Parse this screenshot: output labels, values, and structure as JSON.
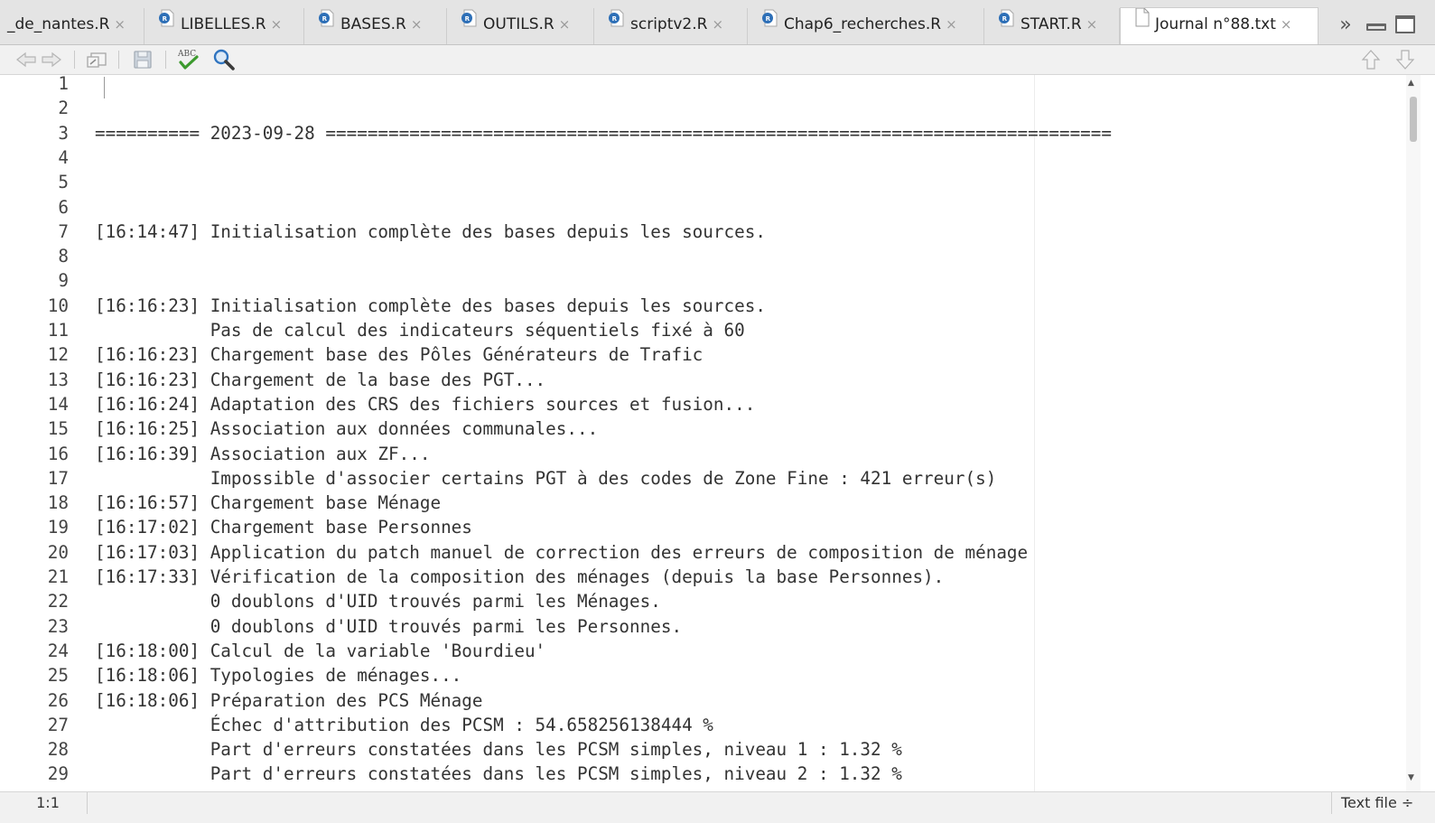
{
  "tabs": [
    {
      "label": "_de_nantes.R",
      "type": "r"
    },
    {
      "label": "LIBELLES.R",
      "type": "r"
    },
    {
      "label": "BASES.R",
      "type": "r"
    },
    {
      "label": "OUTILS.R",
      "type": "r"
    },
    {
      "label": "scriptv2.R",
      "type": "r"
    },
    {
      "label": "Chap6_recherches.R",
      "type": "r"
    },
    {
      "label": "START.R",
      "type": "r"
    },
    {
      "label": "Journal n°88.txt",
      "type": "text",
      "active": true
    }
  ],
  "tab_close_glyph": "×",
  "tab_overflow_glyph": "»",
  "toolbar": {
    "icons": [
      "back-arrow-icon",
      "forward-arrow-icon",
      "show-in-window-icon",
      "save-icon",
      "spellcheck-icon",
      "search-icon",
      "go-up-icon",
      "go-down-icon"
    ],
    "spellcheck_text": "ABC"
  },
  "editor": {
    "lines": [
      {
        "n": "1",
        "text": ""
      },
      {
        "n": "2",
        "text": ""
      },
      {
        "n": "3",
        "text": "========== 2023-09-28 ==========================================================================="
      },
      {
        "n": "4",
        "text": ""
      },
      {
        "n": "5",
        "text": ""
      },
      {
        "n": "6",
        "text": ""
      },
      {
        "n": "7",
        "text": "[16:14:47] Initialisation complète des bases depuis les sources."
      },
      {
        "n": "8",
        "text": ""
      },
      {
        "n": "9",
        "text": ""
      },
      {
        "n": "10",
        "text": "[16:16:23] Initialisation complète des bases depuis les sources."
      },
      {
        "n": "11",
        "text": "           Pas de calcul des indicateurs séquentiels fixé à 60"
      },
      {
        "n": "12",
        "text": "[16:16:23] Chargement base des Pôles Générateurs de Trafic"
      },
      {
        "n": "13",
        "text": "[16:16:23] Chargement de la base des PGT..."
      },
      {
        "n": "14",
        "text": "[16:16:24] Adaptation des CRS des fichiers sources et fusion..."
      },
      {
        "n": "15",
        "text": "[16:16:25] Association aux données communales..."
      },
      {
        "n": "16",
        "text": "[16:16:39] Association aux ZF..."
      },
      {
        "n": "17",
        "text": "           Impossible d'associer certains PGT à des codes de Zone Fine : 421 erreur(s)"
      },
      {
        "n": "18",
        "text": "[16:16:57] Chargement base Ménage"
      },
      {
        "n": "19",
        "text": "[16:17:02] Chargement base Personnes"
      },
      {
        "n": "20",
        "text": "[16:17:03] Application du patch manuel de correction des erreurs de composition de ménage"
      },
      {
        "n": "21",
        "text": "[16:17:33] Vérification de la composition des ménages (depuis la base Personnes)."
      },
      {
        "n": "22",
        "text": "           0 doublons d'UID trouvés parmi les Ménages."
      },
      {
        "n": "23",
        "text": "           0 doublons d'UID trouvés parmi les Personnes."
      },
      {
        "n": "24",
        "text": "[16:18:00] Calcul de la variable 'Bourdieu'"
      },
      {
        "n": "25",
        "text": "[16:18:06] Typologies de ménages..."
      },
      {
        "n": "26",
        "text": "[16:18:06] Préparation des PCS Ménage"
      },
      {
        "n": "27",
        "text": "           Échec d'attribution des PCSM : 54.658256138444 %"
      },
      {
        "n": "28",
        "text": "           Part d'erreurs constatées dans les PCSM simples, niveau 1 : 1.32 %"
      },
      {
        "n": "29",
        "text": "           Part d'erreurs constatées dans les PCSM simples, niveau 2 : 1.32 %"
      }
    ]
  },
  "statusbar": {
    "position": "1:1",
    "file_type": "Text file ÷"
  },
  "colors": {
    "r_icon": "#2d6fb7",
    "spellcheck_check": "#3c9a2e",
    "search_icon": "#2f74c0"
  }
}
